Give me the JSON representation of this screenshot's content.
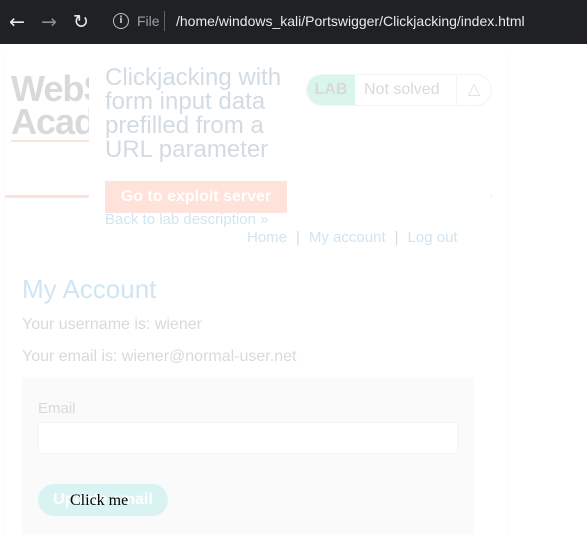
{
  "browser": {
    "file_label": "File",
    "url": "/home/windows_kali/Portswigger/Clickjacking/index.html",
    "icons": [
      "back-arrow-icon",
      "forward-arrow-icon",
      "reload-icon",
      "info-icon"
    ]
  },
  "lab": {
    "logo_line1": "WebS",
    "logo_line2": "Acade",
    "title": "Clickjacking with form input data prefilled from a URL parameter",
    "badge_tag": "LAB",
    "badge_status": "Not solved",
    "exploit_button": "Go to exploit server",
    "back_link": "Back to lab description",
    "back_link_icon": "»"
  },
  "nav": {
    "home": "Home",
    "separator": "|",
    "account": "My account",
    "logout": "Log out"
  },
  "account": {
    "heading": "My Account",
    "username_line": "Your username is: wiener",
    "email_line": "Your email is: wiener@normal-user.net",
    "email_label": "Email",
    "email_value": "",
    "update_button": "Update email"
  },
  "decoy": {
    "label": "Click me"
  },
  "colors": {
    "browser_bar": "#202124",
    "accent_orange": "#ff6633",
    "link_blue": "#0071bc",
    "lab_green": "#33cc99",
    "update_teal": "#33bbbb"
  }
}
